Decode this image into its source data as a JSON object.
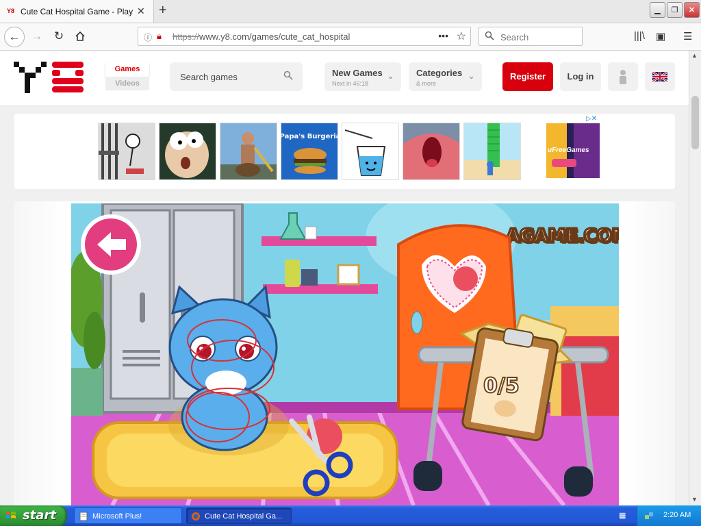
{
  "browser": {
    "tab_title": "Cute Cat Hospital Game - Play onli",
    "tab_favicon_text": "Y8",
    "url_scheme": "https://",
    "url_rest": "www.y8.com/games/cute_cat_hospital",
    "search_placeholder": "Search",
    "new_tab_symbol": "+"
  },
  "site": {
    "tab_games": "Games",
    "tab_videos": "Videos",
    "search_placeholder": "Search games",
    "new_games_label": "New Games",
    "new_games_sub": "Next in 46:18",
    "categories_label": "Categories",
    "categories_sub": "& more",
    "register_label": "Register",
    "login_label": "Log in",
    "ad_text": "uFreeGames",
    "ad_choices": "▷✕"
  },
  "thumbnails": [
    {
      "name": "stickman-prison"
    },
    {
      "name": "cartoon-face"
    },
    {
      "name": "getting-over-it"
    },
    {
      "name": "papas-burgeria",
      "label": "Papa's Burgeria"
    },
    {
      "name": "happy-glass"
    },
    {
      "name": "mouth-game"
    },
    {
      "name": "tower-run"
    }
  ],
  "game": {
    "brand": "AGAME.COM",
    "score": "0/5"
  },
  "taskbar": {
    "start_label": "start",
    "tasks": [
      {
        "label": "Microsoft Plus!"
      },
      {
        "label": "Cute Cat Hospital Ga..."
      }
    ],
    "clock": "2:20 AM"
  },
  "colors": {
    "brand_red": "#d8000c",
    "xp_blue": "#245edb",
    "xp_green": "#3fb548"
  }
}
